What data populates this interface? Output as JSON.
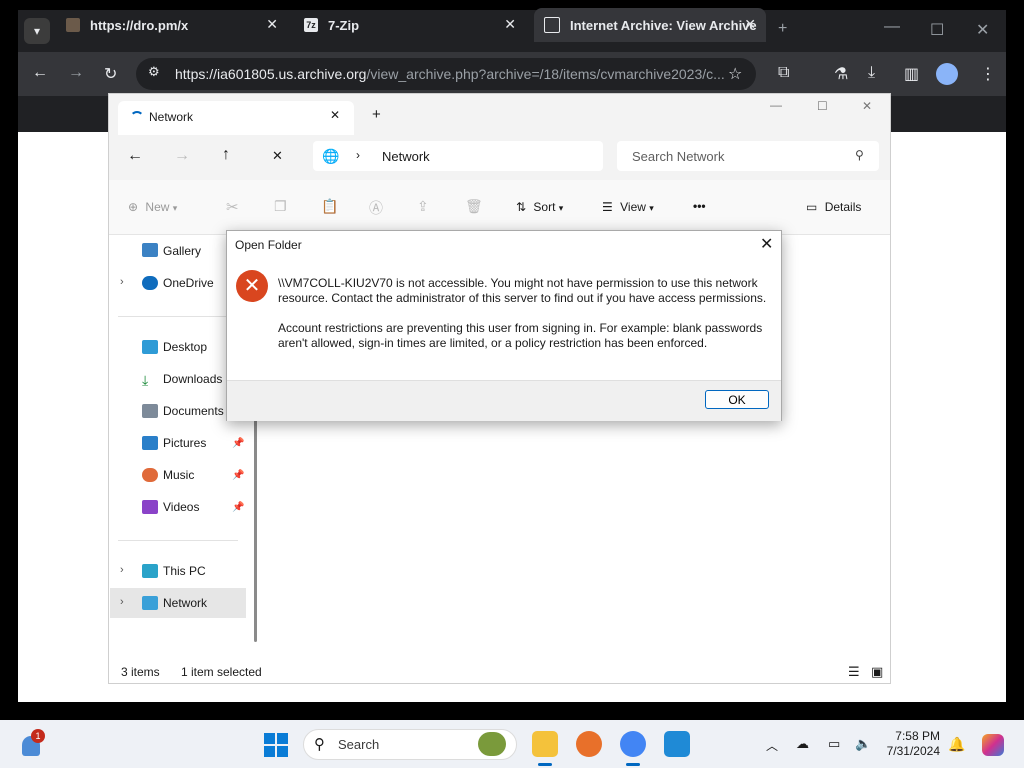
{
  "browser": {
    "tabs": [
      {
        "label": "https://dro.pm/x"
      },
      {
        "label": "7-Zip"
      },
      {
        "label": "Internet Archive: View Archive"
      }
    ],
    "url_host": "https://ia601805.us.archive.org",
    "url_path": "/view_archive.php?archive=/18/items/cvmarchive2023/c..."
  },
  "explorer": {
    "tab_label": "Network",
    "address": "Network",
    "search_placeholder": "Search Network",
    "toolbar": {
      "new": "New",
      "sort": "Sort",
      "view": "View",
      "more": "•••",
      "details": "Details"
    },
    "nav": {
      "gallery": "Gallery",
      "onedrive": "OneDrive",
      "desktop": "Desktop",
      "downloads": "Downloads",
      "documents": "Documents",
      "pictures": "Pictures",
      "music": "Music",
      "videos": "Videos",
      "thispc": "This PC",
      "network": "Network"
    },
    "status": {
      "items": "3 items",
      "selected": "1 item selected"
    }
  },
  "dialog": {
    "title": "Open Folder",
    "message1": "\\\\VM7COLL-KIU2V70 is not accessible. You might not have permission to use this network resource. Contact the administrator of this server to find out if you have access permissions.",
    "message2": "Account restrictions are preventing this user from signing in. For example: blank passwords aren't allowed, sign-in times are limited, or a policy restriction has been enforced.",
    "ok": "OK"
  },
  "taskbar": {
    "search_label": "Search",
    "time": "7:58 PM",
    "date": "7/31/2024",
    "notification_badge": "1"
  },
  "colors": {
    "error": "#d9461f",
    "accent": "#0067c0"
  }
}
